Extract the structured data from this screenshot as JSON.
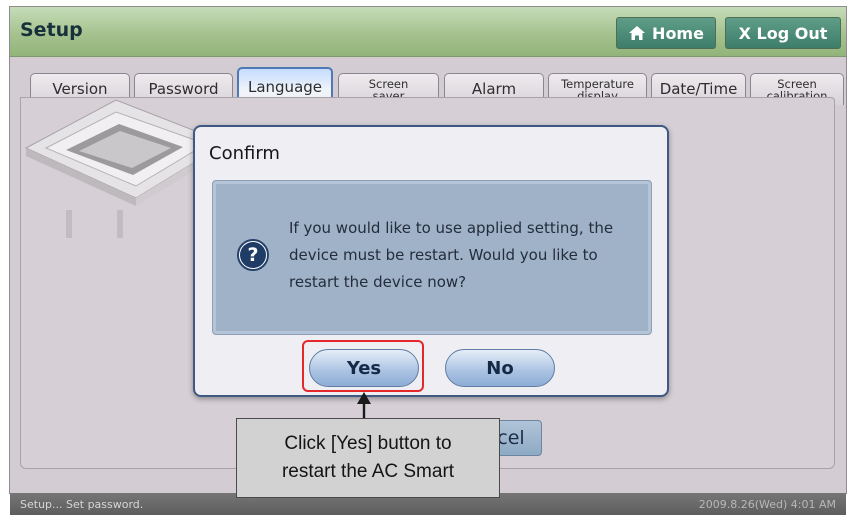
{
  "header": {
    "title": "Setup",
    "home_label": "Home",
    "logout_label": "X Log Out"
  },
  "tabs": [
    {
      "label": "Version",
      "small": false,
      "active": false
    },
    {
      "label": "Password",
      "small": false,
      "active": false
    },
    {
      "label": "Language",
      "small": false,
      "active": true
    },
    {
      "label": "Screen\nsaver",
      "small": true,
      "active": false
    },
    {
      "label": "Alarm",
      "small": false,
      "active": false
    },
    {
      "label": "Temperature\ndisplay",
      "small": true,
      "active": false
    },
    {
      "label": "Date/Time",
      "small": false,
      "active": false
    },
    {
      "label": "Screen\ncalibration",
      "small": true,
      "active": false
    }
  ],
  "background": {
    "cancel_label": "cel"
  },
  "dialog": {
    "title": "Confirm",
    "message": "If you would like to use applied setting, the device must be restart.  Would you like to restart the device now?",
    "icon": "question-icon",
    "yes_label": "Yes",
    "no_label": "No"
  },
  "callout": {
    "text": "Click [Yes] button to\nrestart the AC Smart"
  },
  "status": {
    "message": "Setup... Set password.",
    "datetime": "2009.8.26(Wed)  4:01 AM"
  },
  "colors": {
    "header": "#a5c28f",
    "highlight": "#e5262a",
    "dialog_border": "#3f5a82"
  }
}
